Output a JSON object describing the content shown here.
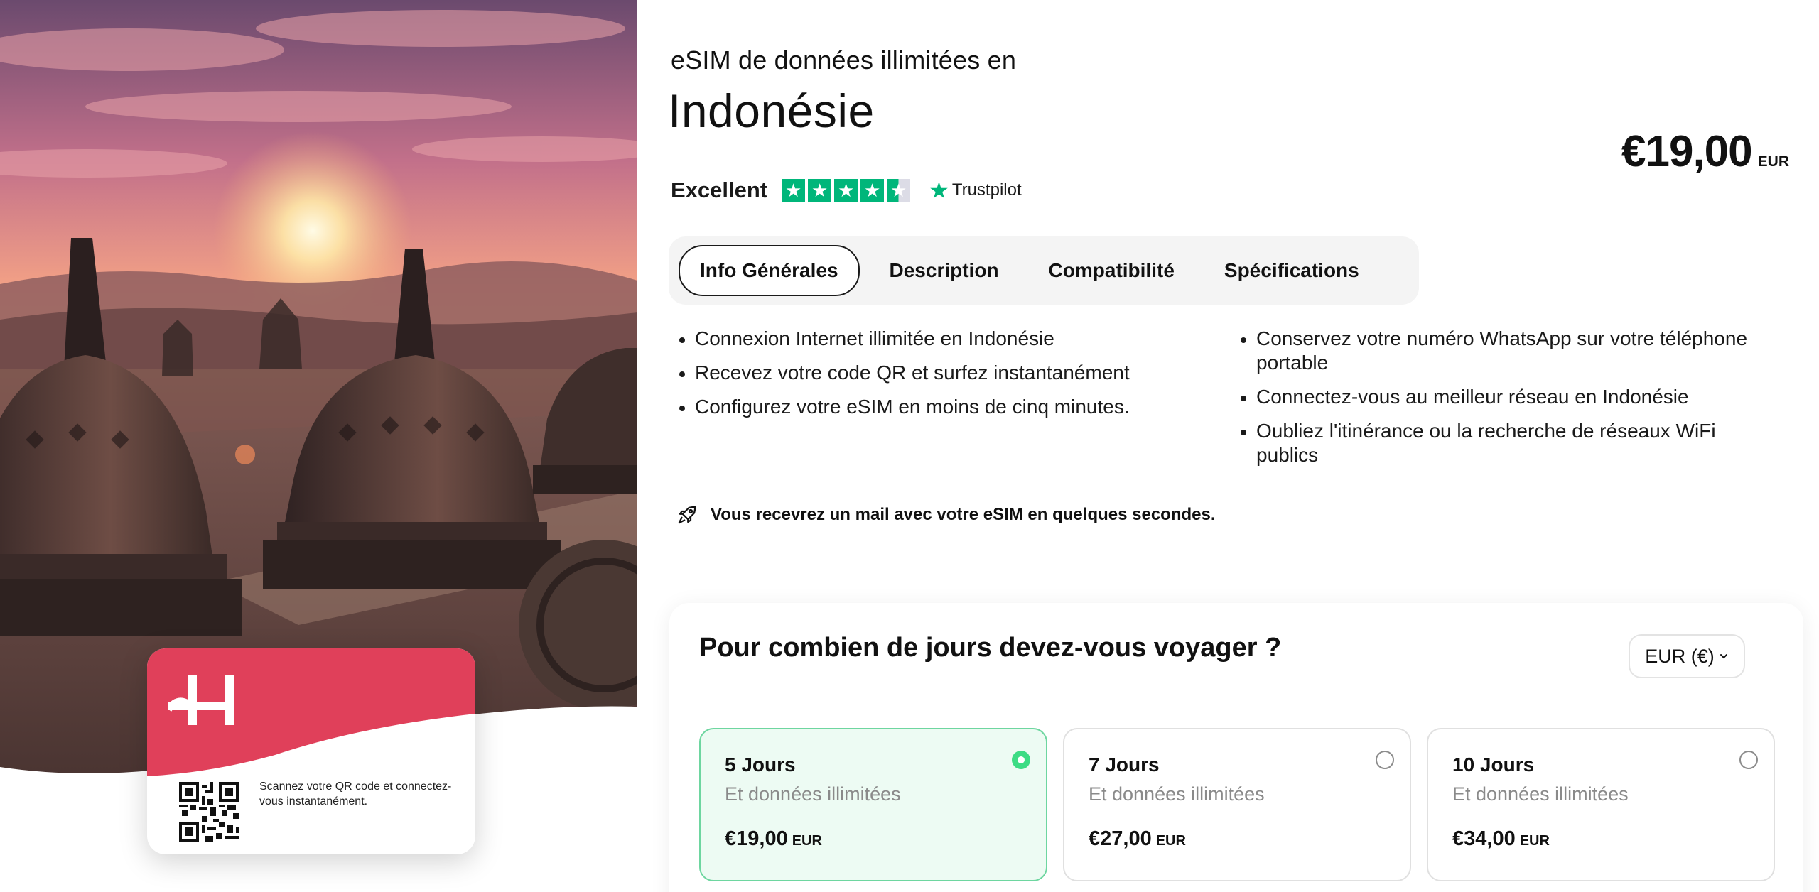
{
  "product": {
    "subtitle": "eSIM de données illimitées en",
    "title": "Indonésie",
    "price": "€19,00",
    "currency": "EUR"
  },
  "rating": {
    "label": "Excellent",
    "stars": 4.5,
    "provider": "Trustpilot",
    "star_color": "#00b67a"
  },
  "tabs": [
    {
      "label": "Info Générales",
      "active": true
    },
    {
      "label": "Description",
      "active": false
    },
    {
      "label": "Compatibilité",
      "active": false
    },
    {
      "label": "Spécifications",
      "active": false
    }
  ],
  "features_left": [
    "Connexion Internet illimitée en Indonésie",
    "Recevez votre code QR et surfez instantanément",
    "Configurez votre eSIM en moins de cinq minutes."
  ],
  "features_right": [
    "Conservez votre numéro WhatsApp sur votre téléphone portable",
    "Connectez-vous au meilleur réseau en Indonésie",
    "Oubliez l'itinérance ou la recherche de réseaux WiFi publics"
  ],
  "mail_note": {
    "icon": "rocket-icon",
    "text": "Vous recevrez un mail avec votre eSIM en quelques secondes."
  },
  "sim_card": {
    "caption": "Scannez votre QR code et connectez-vous instantanément.",
    "brand_color": "#e0405a"
  },
  "days": {
    "question": "Pour combien de jours devez-vous voyager ?",
    "currency_select": "EUR (€)",
    "plans": [
      {
        "title": "5 Jours",
        "subtitle": "Et données illimitées",
        "price": "€19,00",
        "currency": "EUR",
        "selected": true
      },
      {
        "title": "7 Jours",
        "subtitle": "Et données illimitées",
        "price": "€27,00",
        "currency": "EUR",
        "selected": false
      },
      {
        "title": "10 Jours",
        "subtitle": "Et données illimitées",
        "price": "€34,00",
        "currency": "EUR",
        "selected": false
      }
    ]
  },
  "colors": {
    "accent_green": "#3ddc84",
    "selected_bg": "#edfbf3"
  }
}
